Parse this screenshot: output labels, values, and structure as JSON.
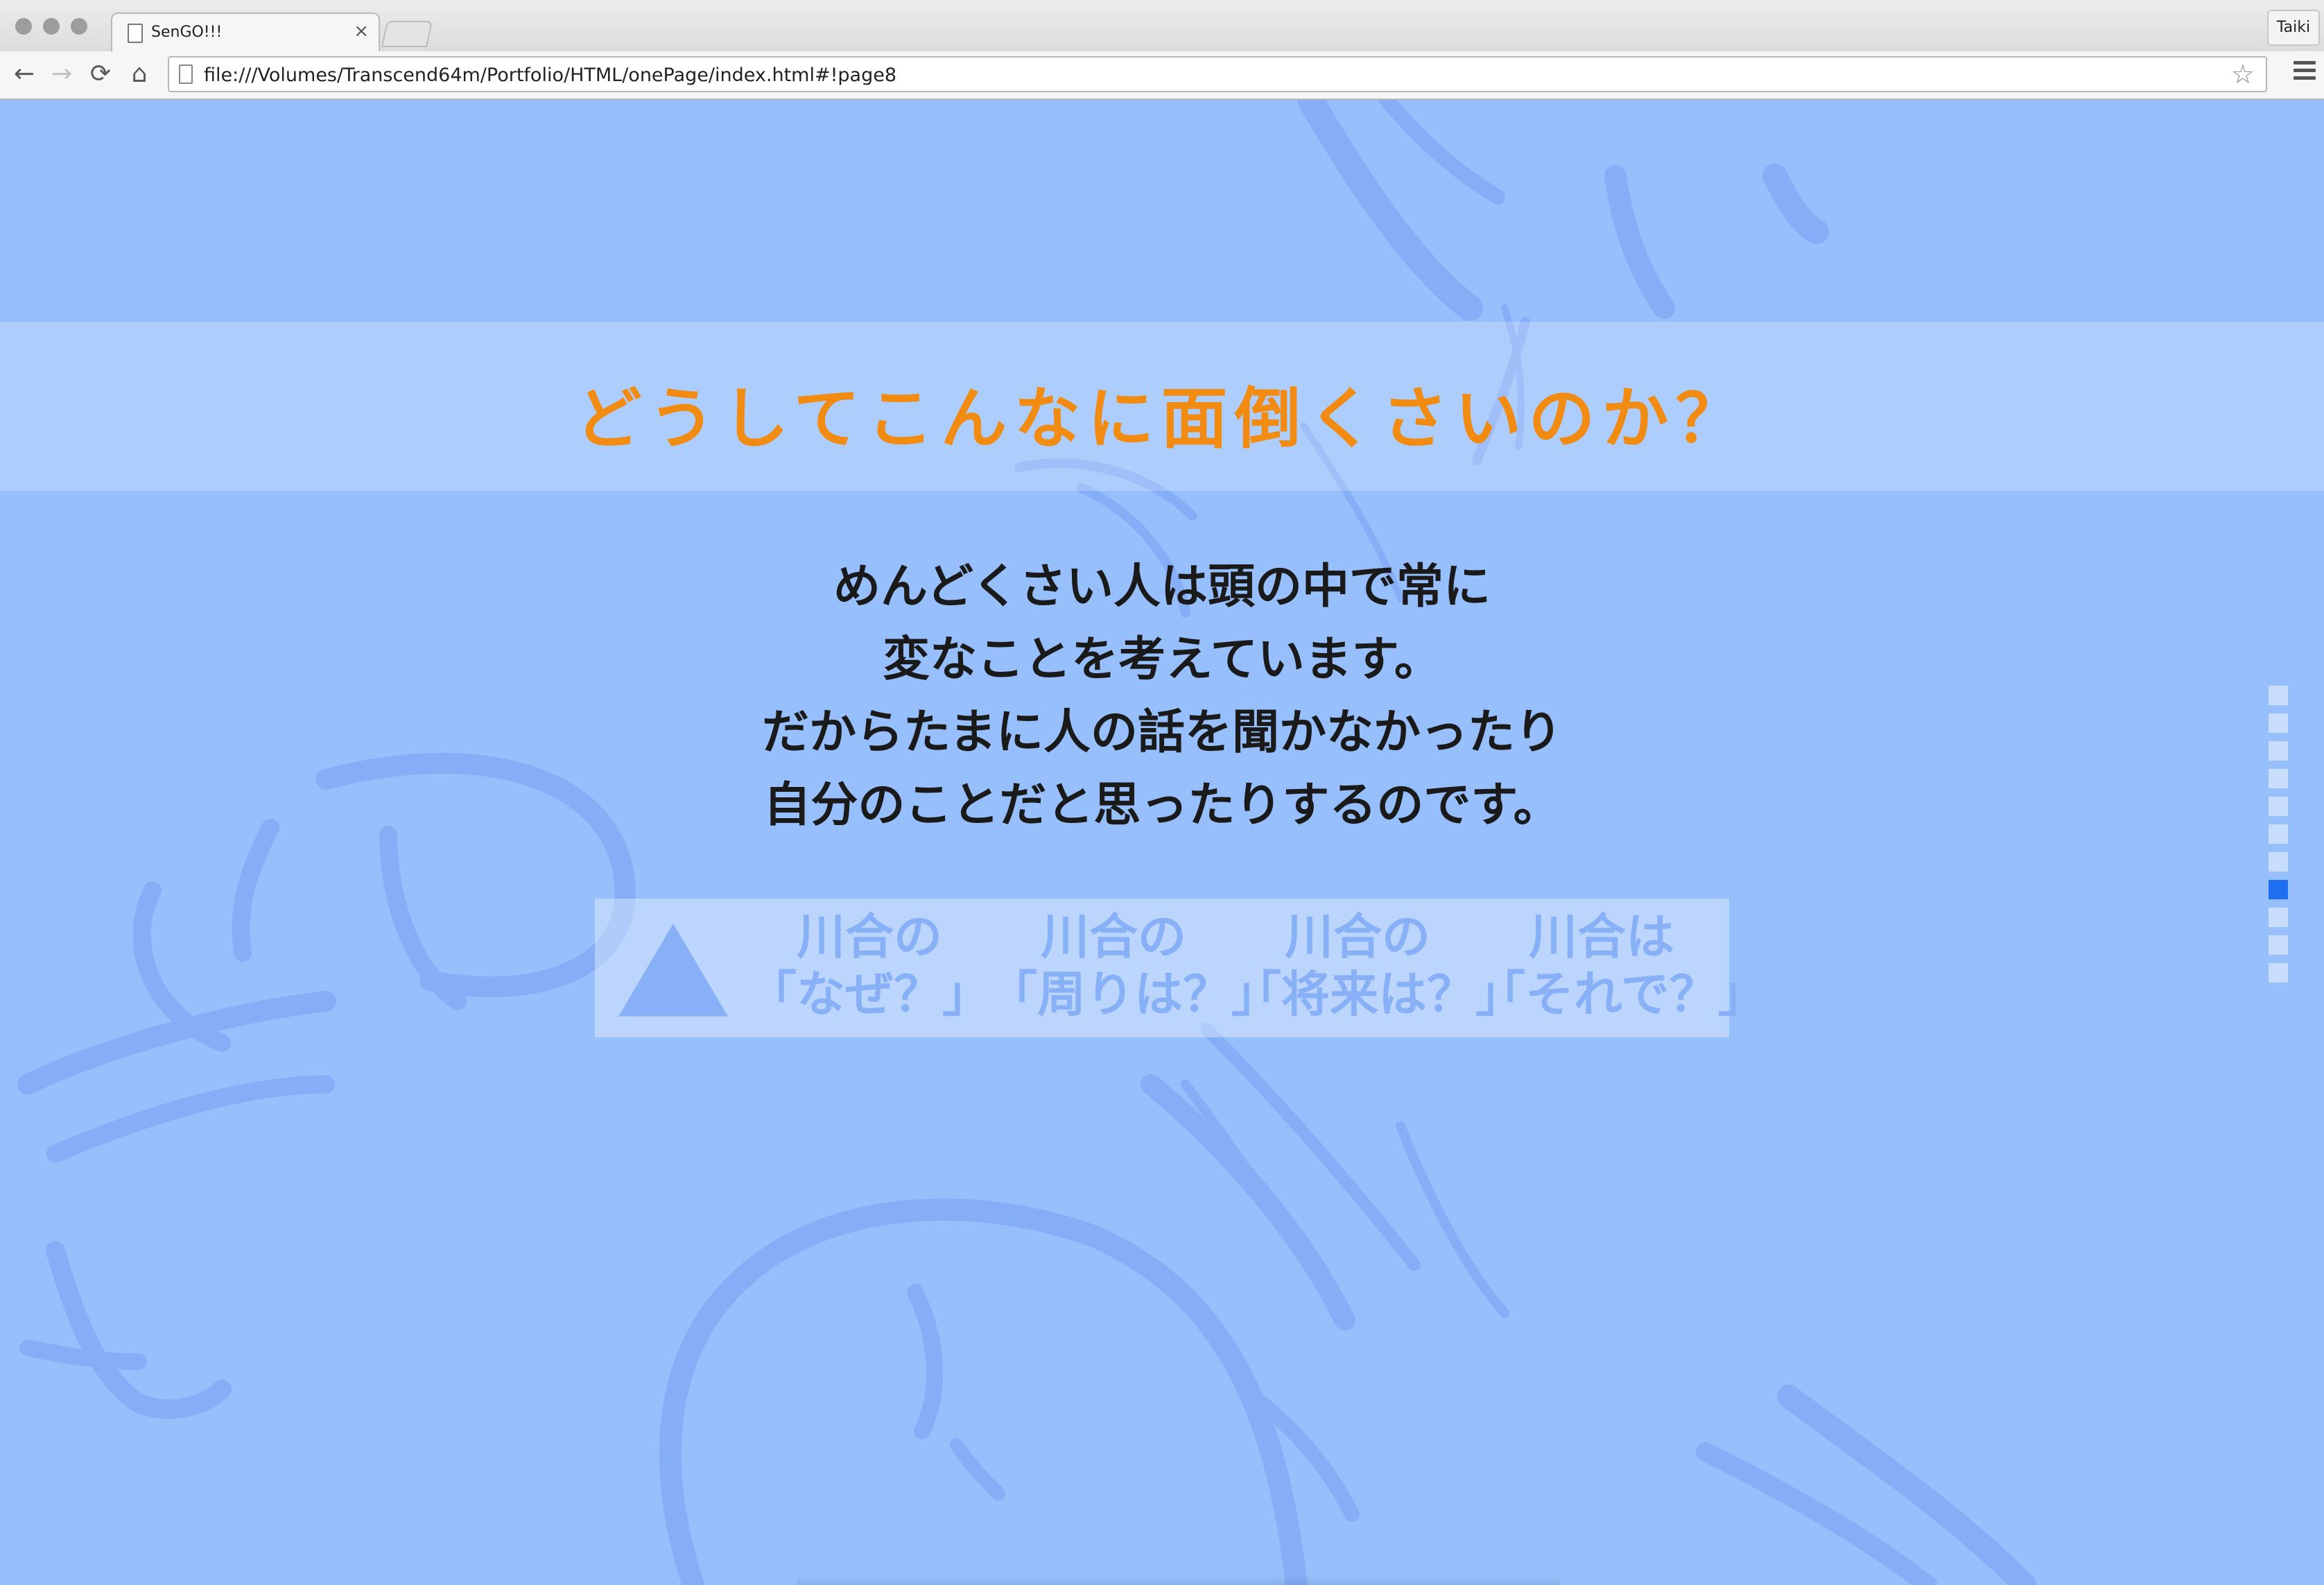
{
  "browser": {
    "tab_title": "SenGO!!!",
    "tab_close": "×",
    "profile_name": "Taiki",
    "url": "file:///Volumes/Transcend64m/Portfolio/HTML/onePage/index.html#!page8",
    "back_glyph": "←",
    "forward_glyph": "→",
    "reload_glyph": "⟳",
    "home_glyph": "⌂",
    "star_glyph": "☆"
  },
  "page": {
    "headline": "どうしてこんなに面倒くさいのか？",
    "body_lines": [
      "めんどくさい人は頭の中で常に",
      "変なことを考えています。",
      "だからたまに人の話を聞かなかったり",
      "自分のことだと思ったりするのです。"
    ],
    "links": [
      {
        "line1": "川合の",
        "line2": "「なぜ？」"
      },
      {
        "line1": "川合の",
        "line2": "「周りは？」"
      },
      {
        "line1": "川合の",
        "line2": "「将来は？」"
      },
      {
        "line1": "川合は",
        "line2": "「それで？」"
      }
    ],
    "pager": {
      "total": 11,
      "active_index": 7
    }
  },
  "colors": {
    "background": "#97bffc",
    "headline": "#f28b12",
    "body_text": "#1a1a1a",
    "links": "#88b0f7",
    "pager_active": "#1e6ef0"
  },
  "icons": {
    "triangle": "triangle-up-icon",
    "tab_page": "page-icon",
    "omnibox_page": "page-icon",
    "bookmark": "star-icon",
    "menu": "hamburger-menu-icon"
  }
}
